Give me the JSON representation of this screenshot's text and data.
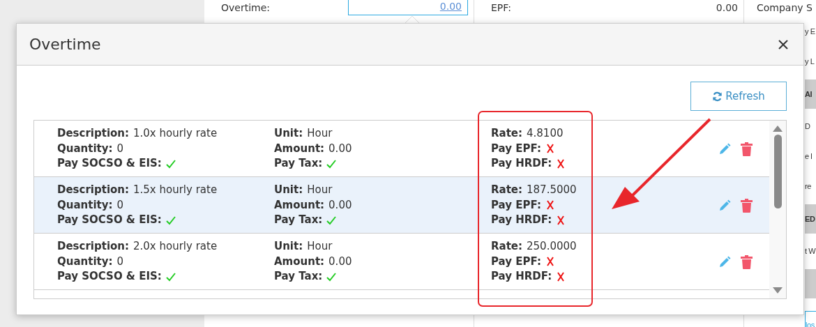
{
  "background": {
    "fields": [
      {
        "label": "Overtime:",
        "value": "0.00",
        "kind": "input"
      },
      {
        "label": "EPF:",
        "value": "0.00",
        "kind": "text"
      }
    ],
    "side_title": "Company S",
    "side_items": [
      {
        "kind": "text",
        "text": "y E"
      },
      {
        "kind": "text",
        "text": "y L"
      },
      {
        "kind": "band",
        "text": "AI"
      },
      {
        "kind": "text",
        "text": "D"
      },
      {
        "kind": "text",
        "text": "e l"
      },
      {
        "kind": "text",
        "text": "re"
      },
      {
        "kind": "band",
        "text": "ED"
      },
      {
        "kind": "text",
        "text": "t W"
      },
      {
        "kind": "band"
      },
      {
        "kind": "button",
        "text": "los"
      }
    ]
  },
  "modal": {
    "title": "Overtime",
    "refresh_label": "Refresh",
    "rows": [
      {
        "selected": false,
        "columns": [
          [
            {
              "kind": "text",
              "label": "Description:",
              "value": "1.0x hourly rate"
            },
            {
              "kind": "text",
              "label": "Quantity:",
              "value": "0"
            },
            {
              "kind": "flag",
              "label": "Pay SOCSO & EIS:",
              "on": true
            }
          ],
          [
            {
              "kind": "text",
              "label": "Unit:",
              "value": "Hour"
            },
            {
              "kind": "text",
              "label": "Amount:",
              "value": "0.00"
            },
            {
              "kind": "flag",
              "label": "Pay Tax:",
              "on": true
            }
          ],
          [
            {
              "kind": "text",
              "label": "Rate:",
              "value": "4.8100"
            },
            {
              "kind": "flag",
              "label": "Pay EPF:",
              "on": false
            },
            {
              "kind": "flag",
              "label": "Pay HRDF:",
              "on": false
            }
          ]
        ]
      },
      {
        "selected": true,
        "columns": [
          [
            {
              "kind": "text",
              "label": "Description:",
              "value": "1.5x hourly rate"
            },
            {
              "kind": "text",
              "label": "Quantity:",
              "value": "0"
            },
            {
              "kind": "flag",
              "label": "Pay SOCSO & EIS:",
              "on": true
            }
          ],
          [
            {
              "kind": "text",
              "label": "Unit:",
              "value": "Hour"
            },
            {
              "kind": "text",
              "label": "Amount:",
              "value": "0.00"
            },
            {
              "kind": "flag",
              "label": "Pay Tax:",
              "on": true
            }
          ],
          [
            {
              "kind": "text",
              "label": "Rate:",
              "value": "187.5000"
            },
            {
              "kind": "flag",
              "label": "Pay EPF:",
              "on": false
            },
            {
              "kind": "flag",
              "label": "Pay HRDF:",
              "on": false
            }
          ]
        ]
      },
      {
        "selected": false,
        "columns": [
          [
            {
              "kind": "text",
              "label": "Description:",
              "value": "2.0x hourly rate"
            },
            {
              "kind": "text",
              "label": "Quantity:",
              "value": "0"
            },
            {
              "kind": "flag",
              "label": "Pay SOCSO & EIS:",
              "on": true
            }
          ],
          [
            {
              "kind": "text",
              "label": "Unit:",
              "value": "Hour"
            },
            {
              "kind": "text",
              "label": "Amount:",
              "value": "0.00"
            },
            {
              "kind": "flag",
              "label": "Pay Tax:",
              "on": true
            }
          ],
          [
            {
              "kind": "text",
              "label": "Rate:",
              "value": "250.0000"
            },
            {
              "kind": "flag",
              "label": "Pay EPF:",
              "on": false
            },
            {
              "kind": "flag",
              "label": "Pay HRDF:",
              "on": false
            }
          ]
        ]
      }
    ]
  }
}
